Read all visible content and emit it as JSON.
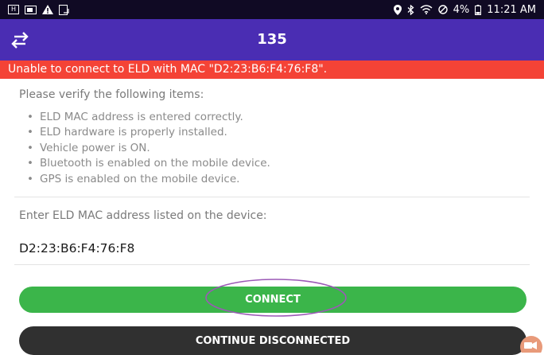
{
  "status_bar": {
    "left_icons": [
      "h-icon",
      "cast-icon",
      "alert-icon",
      "screenshot-icon"
    ],
    "h_glyph": "H",
    "battery": "4%",
    "time": "11:21 AM"
  },
  "app_bar": {
    "title": "135"
  },
  "error_banner": {
    "text": "Unable to connect to ELD with MAC \"D2:23:B6:F4:76:F8\"."
  },
  "verify": {
    "heading": "Please verify the following items:",
    "items": [
      "ELD MAC address is entered correctly.",
      "ELD hardware is properly installed.",
      "Vehicle power is ON.",
      "Bluetooth is enabled on the mobile device.",
      "GPS is enabled on the mobile device."
    ]
  },
  "mac": {
    "label": "Enter ELD MAC address listed on the device:",
    "value": "D2:23:B6:F4:76:F8"
  },
  "buttons": {
    "connect_label": "CONNECT",
    "continue_label": "CONTINUE DISCONNECTED"
  },
  "colors": {
    "app_bar": "#4a2db3",
    "error_banner": "#f44336",
    "connect_button": "#3bb54a",
    "continue_button": "#303030",
    "annotation": "#9b59b6",
    "status_bar": "#100a24"
  }
}
